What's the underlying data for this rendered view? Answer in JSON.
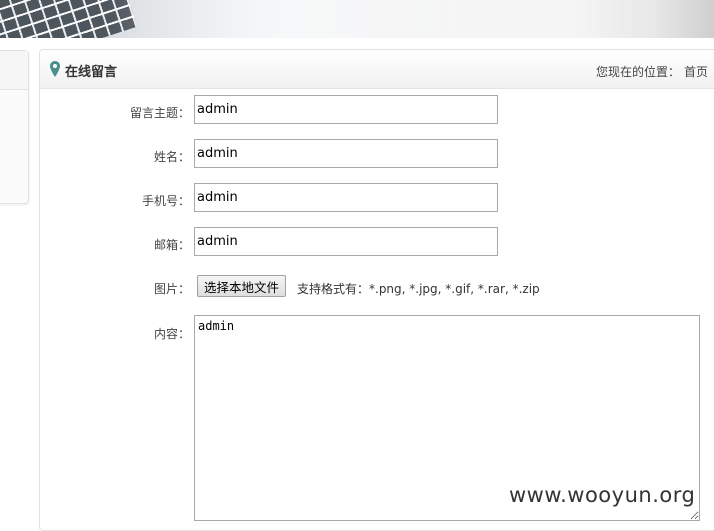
{
  "header": {
    "title": "在线留言",
    "location_label": "您现在的位置：",
    "location_home": "首页"
  },
  "form": {
    "subject": {
      "label": "留言主题：",
      "value": "admin"
    },
    "name": {
      "label": "姓名：",
      "value": "admin"
    },
    "phone": {
      "label": "手机号：",
      "value": "admin"
    },
    "email": {
      "label": "邮箱：",
      "value": "admin"
    },
    "image": {
      "label": "图片：",
      "button": "选择本地文件",
      "hint": "支持格式有：*.png, *.jpg, *.gif, *.rar, *.zip"
    },
    "content": {
      "label": "内容：",
      "value": "admin"
    }
  },
  "watermark": "www.wooyun.org",
  "colors": {
    "pin": "#4a8f8a"
  }
}
